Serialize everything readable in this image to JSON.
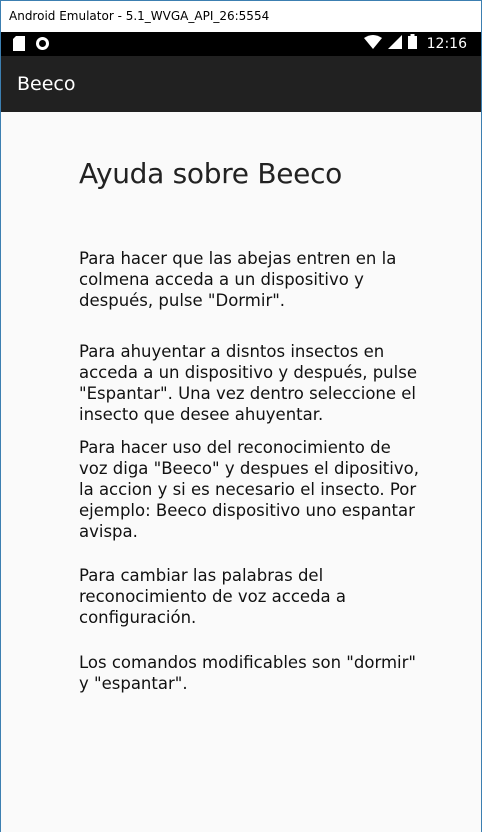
{
  "window": {
    "title": "Android Emulator - 5.1_WVGA_API_26:5554"
  },
  "status_bar": {
    "time": "12:16",
    "icons_left": [
      "sd-card-icon",
      "circle-notification-icon"
    ],
    "icons_right": [
      "wifi-icon",
      "signal-icon",
      "battery-icon"
    ]
  },
  "app_bar": {
    "title": "Beeco"
  },
  "help": {
    "title": "Ayuda sobre Beeco",
    "paragraphs": [
      "Para hacer que las abejas entren en la colmena acceda a un dispositivo y después, pulse \"Dormir\".",
      "Para ahuyentar a disntos insectos en acceda a un dispositivo y después, pulse \"Espantar\". Una vez dentro seleccione el insecto que desee ahuyentar.",
      "Para hacer uso del reconocimiento de voz diga \"Beeco\" y despues el dipositivo, la accion y si es necesario el insecto. Por ejemplo: Beeco dispositivo uno espantar avispa.",
      "Para cambiar las palabras del reconocimiento de voz acceda a configuración.",
      "Los comandos modificables son \"dormir\" y \"espantar\"."
    ]
  },
  "colors": {
    "app_bar": "#212121",
    "status_bar": "#000000",
    "background": "#fafafa",
    "window_border": "#3c7fb1"
  }
}
